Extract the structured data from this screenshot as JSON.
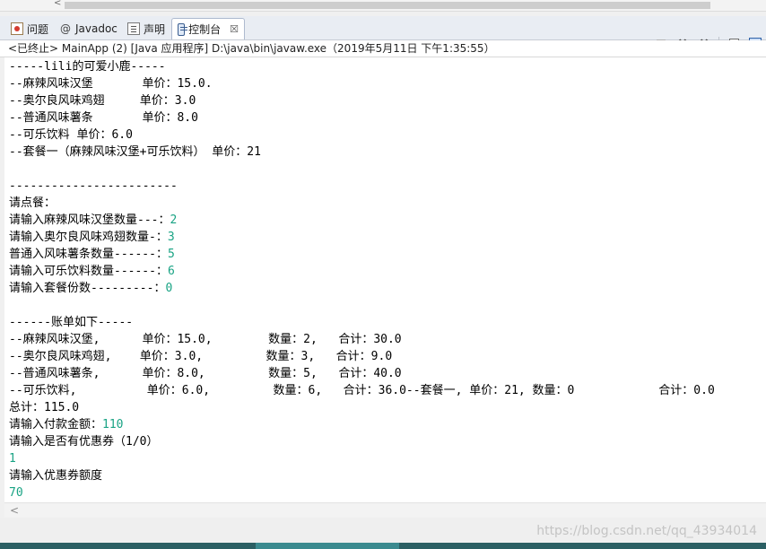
{
  "tabs": [
    {
      "label": "问题",
      "icon": "problems-icon"
    },
    {
      "label": "Javadoc",
      "icon": "javadoc-icon",
      "glyph": "@"
    },
    {
      "label": "声明",
      "icon": "declaration-icon"
    },
    {
      "label": "控制台",
      "icon": "console-icon",
      "close": "☒"
    }
  ],
  "toolbar": {
    "icons": [
      "stop-icon",
      "remove-launch-icon",
      "remove-all-icon",
      "clear-console-icon",
      "scroll-lock-icon"
    ]
  },
  "status_line": "<已终止> MainApp (2) [Java 应用程序] D:\\java\\bin\\javaw.exe（2019年5月11日 下午1:35:55）",
  "console": {
    "lines": [
      {
        "text": "-----lili的可爱小鹿-----"
      },
      {
        "text": "--麻辣风味汉堡       单价：15.0."
      },
      {
        "text": "--奥尔良风味鸡翅     单价：3.0"
      },
      {
        "text": "--普通风味薯条       单价：8.0"
      },
      {
        "text": "--可乐饮料 单价：6.0"
      },
      {
        "text": "--套餐一（麻辣风味汉堡+可乐饮料） 单价：21"
      },
      {
        "text": ""
      },
      {
        "text": "------------------------"
      },
      {
        "text": "请点餐："
      },
      {
        "text": "请输入麻辣风味汉堡数量---：",
        "input": "2"
      },
      {
        "text": "请输入奥尔良风味鸡翅数量-：",
        "input": "3"
      },
      {
        "text": "普通入风味薯条数量------：",
        "input": "5"
      },
      {
        "text": "请输入可乐饮料数量------：",
        "input": "6"
      },
      {
        "text": "请输入套餐份数---------：",
        "input": "0"
      },
      {
        "text": ""
      },
      {
        "text": "------账单如下-----"
      },
      {
        "text": "--麻辣风味汉堡,      单价：15.0,        数量：2,   合计：30.0"
      },
      {
        "text": "--奥尔良风味鸡翅,    单价：3.0,         数量：3,   合计：9.0"
      },
      {
        "text": "--普通风味薯条,      单价：8.0,         数量：5,   合计：40.0"
      },
      {
        "text": "--可乐饮料,          单价：6.0,         数量：6,   合计：36.0--套餐一, 单价：21, 数量：0            合计：0.0"
      },
      {
        "text": "总计：115.0"
      },
      {
        "text": "请输入付款金额：",
        "input": "110"
      },
      {
        "text": "请输入是否有优惠券（1/0）"
      },
      {
        "text": "",
        "input": "1"
      },
      {
        "text": "请输入优惠券额度"
      },
      {
        "text": "",
        "input": "70"
      }
    ]
  },
  "watermark": "https://blog.csdn.net/qq_43934014",
  "colors": {
    "input_text": "#19a384",
    "taskbar": "#2b5f63"
  }
}
